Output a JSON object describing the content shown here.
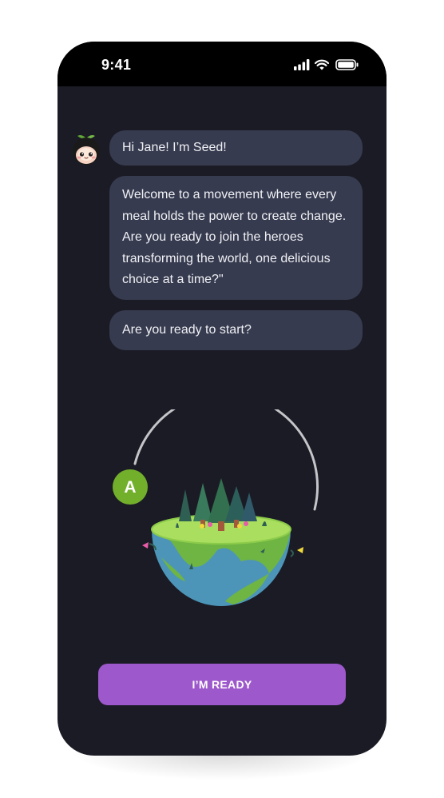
{
  "status_bar": {
    "time": "9:41",
    "icons": [
      "signal-icon",
      "wifi-icon",
      "battery-icon"
    ]
  },
  "chat": {
    "avatar_icon": "seed-avatar-icon",
    "messages": [
      "Hi Jane! I’m Seed!",
      "Welcome to a movement where every meal holds the power to create change. Are you ready to join the heroes transforming the world, one delicious choice at a time?\"",
      "Are you ready to start?"
    ]
  },
  "illustration": {
    "progress_marker": "A",
    "icon": "earth-forest-icon"
  },
  "cta": {
    "label": "I’M READY"
  },
  "colors": {
    "background": "#1b1b25",
    "bubble": "#373b4f",
    "accent": "#9d58cc",
    "marker": "#72b02c"
  }
}
